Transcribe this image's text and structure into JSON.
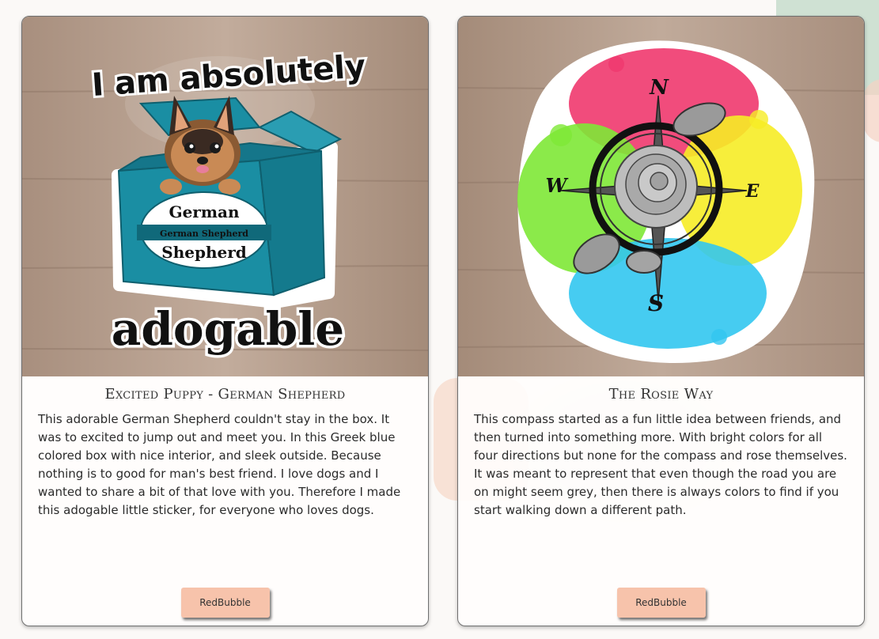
{
  "cards": [
    {
      "image_text": {
        "top": "I am absolutely",
        "bottom": "adogable",
        "label_line1": "German",
        "label_banner": "German Shepherd",
        "label_line2": "Shepherd"
      },
      "title": "Excited Puppy - German Shepherd",
      "description": "This adorable German Shepherd couldn't stay in the box. It was to excited to jump out and meet you. In this Greek blue colored box with nice interior, and sleek outside. Because nothing is to good for man's best friend. I love dogs and I wanted to share a bit of that love with you. Therefore I made this adogable little sticker, for everyone who loves dogs.",
      "button_label": "RedBubble"
    },
    {
      "image_text": {
        "north": "N",
        "east": "E",
        "south": "S",
        "west": "W"
      },
      "title": "The Rosie Way",
      "description": "This compass started as a fun little idea between friends, and then turned into something more. With bright colors for all four directions but none for the compass and rose themselves. It was meant to represent that even though the road you are on might seem grey, then there is always colors to find if you start walking down a different path.",
      "button_label": "RedBubble"
    }
  ],
  "colors": {
    "button": "#f7c3ab",
    "box_teal": "#1a8ea3",
    "wood": "#b79e8c",
    "splash_pink": "#f0386e",
    "splash_yellow": "#f6ec26",
    "splash_green": "#7ee836",
    "splash_blue": "#32c6f0"
  }
}
